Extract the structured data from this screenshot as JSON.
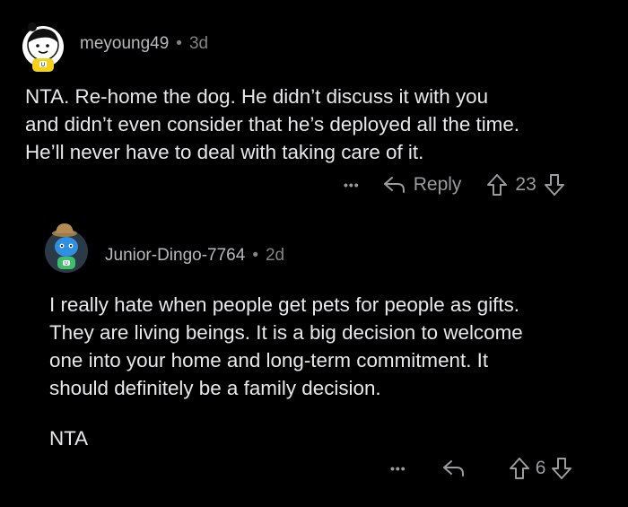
{
  "comments": [
    {
      "username": "meyoung49",
      "separator": "•",
      "age": "3d",
      "body": [
        "NTA.  Re-home the dog.  He didn’t discuss it with you",
        "and didn’t even consider that he’s deployed all the time.",
        "He’ll never have to deal with taking care of it."
      ],
      "actions": {
        "more": "•••",
        "reply_label": "Reply",
        "vote_count": "23"
      }
    },
    {
      "username": "Junior-Dingo-7764",
      "separator": "•",
      "age": "2d",
      "body": [
        "I really hate when people get pets for people as gifts.",
        "They are living beings. It is a big decision to welcome",
        "one into your home and long-term commitment. It",
        "should definitely be a family decision."
      ],
      "body_extra": "NTA",
      "actions": {
        "more": "•••",
        "reply_label": "",
        "vote_count": "6"
      }
    }
  ],
  "colors": {
    "background": "#000000",
    "text": "#e6e8ea",
    "muted": "#818384",
    "avatar1_bg": "#ffffff",
    "avatar2_bg": "#2b3a4a"
  }
}
